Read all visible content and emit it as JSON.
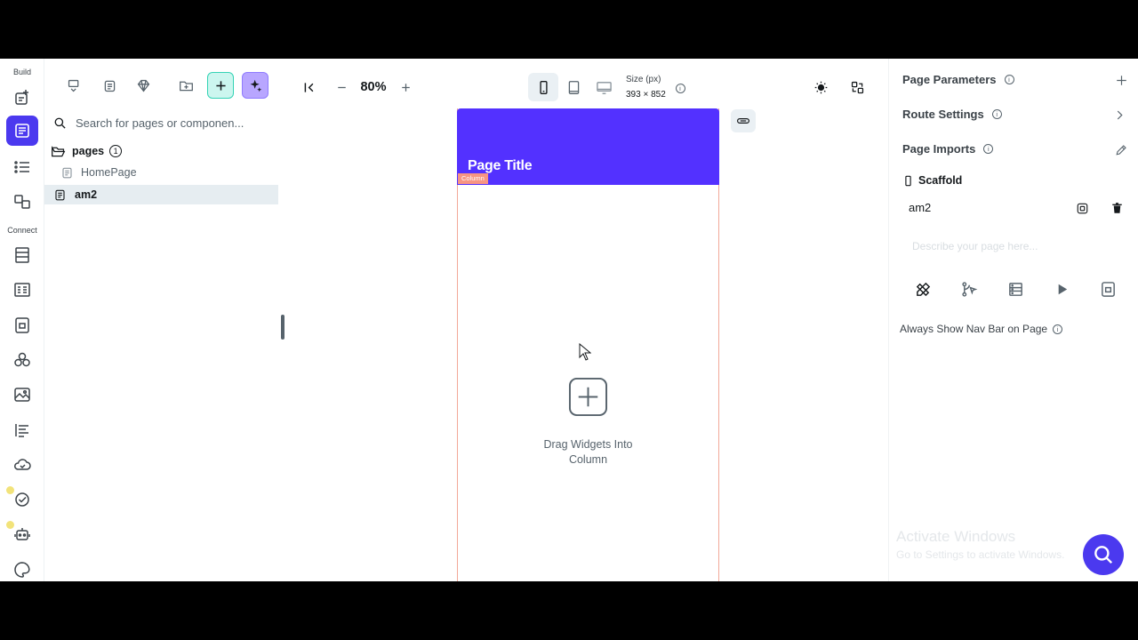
{
  "colors": {
    "primary": "#4b39ef",
    "app_bar": "#5331ff",
    "column_outline": "#f2a898",
    "column_tag": "#f79583",
    "selected_row": "#e6edf1",
    "add_button": "#ccf6ef",
    "ai_button": "#b8a6ff"
  },
  "rail": {
    "build_label": "Build",
    "connect_label": "Connect",
    "icons": [
      "add-page-icon",
      "widget-tree-icon",
      "storyboard-icon",
      "components-icon",
      "firestore-icon",
      "api-calls-icon",
      "app-state-icon",
      "custom-code-icon",
      "media-assets-icon",
      "app-values-icon",
      "cloud-functions-icon",
      "test-icon",
      "agents-icon",
      "theme-icon"
    ]
  },
  "tree": {
    "toolbar_icons": [
      "widget-palette-icon",
      "layers-icon",
      "gem-icon",
      "new-folder-icon",
      "add-icon",
      "ai-sparkle-icon"
    ],
    "search_placeholder": "Search for pages or componen...",
    "folder_label": "pages",
    "folder_count": "1",
    "items": [
      {
        "label": "HomePage",
        "selected": false
      },
      {
        "label": "am2",
        "selected": true
      }
    ]
  },
  "canvas_toolbar": {
    "zoom": "80%",
    "size_label": "Size (px)",
    "size_value": "393 × 852",
    "selected_device": "phone",
    "devices": [
      "phone",
      "tablet",
      "desktop"
    ]
  },
  "phone": {
    "page_title": "Page Title",
    "column_tag": "Column",
    "drop_hint": "Drag Widgets Into Column"
  },
  "right_panel": {
    "page_parameters": "Page Parameters",
    "route_settings": "Route Settings",
    "page_imports": "Page Imports",
    "scaffold": "Scaffold",
    "page_name": "am2",
    "description_placeholder": "Describe your page here...",
    "nav_bar_toggle_label": "Always Show Nav Bar on Page"
  },
  "os_watermark": {
    "line1": "Activate Windows",
    "line2": "Go to Settings to activate Windows."
  }
}
